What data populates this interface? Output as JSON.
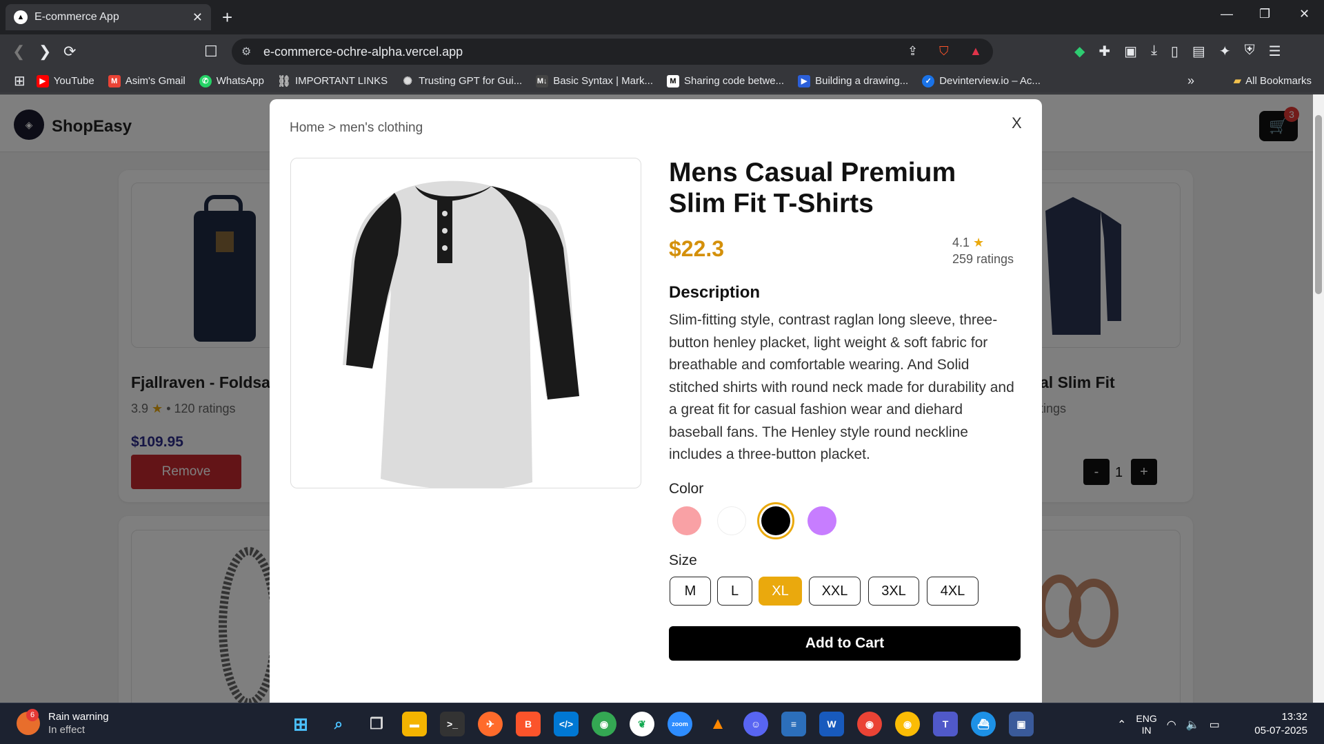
{
  "browser": {
    "tab_title": "E-commerce App",
    "tab_close": "✕",
    "new_tab": "+",
    "url": "e-commerce-ochre-alpha.vercel.app",
    "bookmarks": [
      {
        "label": "YouTube",
        "color": "#ff0000"
      },
      {
        "label": "Asim's Gmail",
        "color": "#ea4335"
      },
      {
        "label": "WhatsApp",
        "color": "#25d366"
      },
      {
        "label": "IMPORTANT LINKS",
        "color": "#9aa0a6"
      },
      {
        "label": "Trusting GPT for Gui...",
        "color": "#9aa0a6"
      },
      {
        "label": "Basic Syntax | Mark...",
        "color": "#444444"
      },
      {
        "label": "Sharing code betwe...",
        "color": "#000000"
      },
      {
        "label": "Building a drawing...",
        "color": "#2b5fd9"
      },
      {
        "label": "Devinterview.io – Ac...",
        "color": "#1a73e8"
      }
    ],
    "all_bookmarks": "All Bookmarks"
  },
  "app": {
    "brand": "ShopEasy",
    "cart_count": "3"
  },
  "background_products": [
    {
      "title": "Fjallraven - Foldsa",
      "rating": "3.9",
      "ratings_count": "120 ratings",
      "price": "$109.95",
      "remove_label": "Remove"
    },
    {
      "title": "al Slim Fit",
      "ratings_count": "tings",
      "qty_minus": "-",
      "qty_value": "1",
      "qty_plus": "+"
    }
  ],
  "modal": {
    "breadcrumb": "Home > men's clothing",
    "close_label": "X",
    "title": "Mens Casual Premium Slim Fit T-Shirts",
    "price": "$22.3",
    "rating": "4.1",
    "ratings_count": "259 ratings",
    "description_heading": "Description",
    "description": "Slim-fitting style, contrast raglan long sleeve, three-button henley placket, light weight & soft fabric for breathable and comfortable wearing. And Solid stitched shirts with round neck made for durability and a great fit for casual fashion wear and diehard baseball fans. The Henley style round neckline includes a three-button placket.",
    "color_label": "Color",
    "colors": [
      "#f9a1a5",
      "#ffffff",
      "#000000",
      "#c77dff"
    ],
    "selected_color": "#000000",
    "size_label": "Size",
    "sizes": [
      "M",
      "L",
      "XL",
      "XXL",
      "3XL",
      "4XL"
    ],
    "selected_size": "XL",
    "add_to_cart": "Add to Cart",
    "accent_color": "#eaa90d"
  },
  "taskbar": {
    "weather_title": "Rain warning",
    "weather_sub": "In effect",
    "weather_badge": "6",
    "lang_top": "ENG",
    "lang_bottom": "IN",
    "time": "13:32",
    "date": "05-07-2025"
  }
}
